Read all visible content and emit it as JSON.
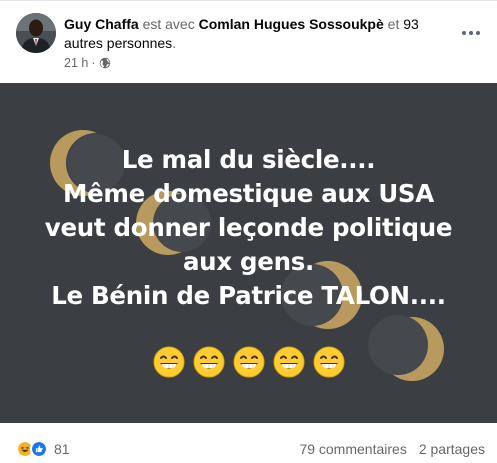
{
  "post": {
    "author": "Guy Chaffa",
    "with_text": "est avec",
    "tagged_person": "Comlan Hugues Sossoukpè",
    "and_text": "et",
    "others_link": "93 autres personnes",
    "period": ".",
    "timestamp": "21 h",
    "dot": "·",
    "audience_icon": "globe-icon",
    "more_icon": "more-options-icon"
  },
  "image_text": {
    "lines": [
      "Le mal du siècle....",
      "Même domestique aux USA",
      "veut donner leçonde politique",
      "aux gens.",
      "Le Bénin de Patrice TALON...."
    ],
    "emoji_icon": "grinning-face-with-smiling-eyes-emoji",
    "emoji_count": 5
  },
  "footer": {
    "reaction_icons": [
      "haha-icon",
      "like-icon"
    ],
    "reaction_count": "81",
    "comments": "79 commentaires",
    "shares": "2 partages"
  },
  "colors": {
    "image_background": "#3b3e43",
    "moon_gold": "#b89a5e",
    "like_blue": "#1877f2",
    "haha_yellow": "#f7b125",
    "secondary_text": "#65676b"
  }
}
